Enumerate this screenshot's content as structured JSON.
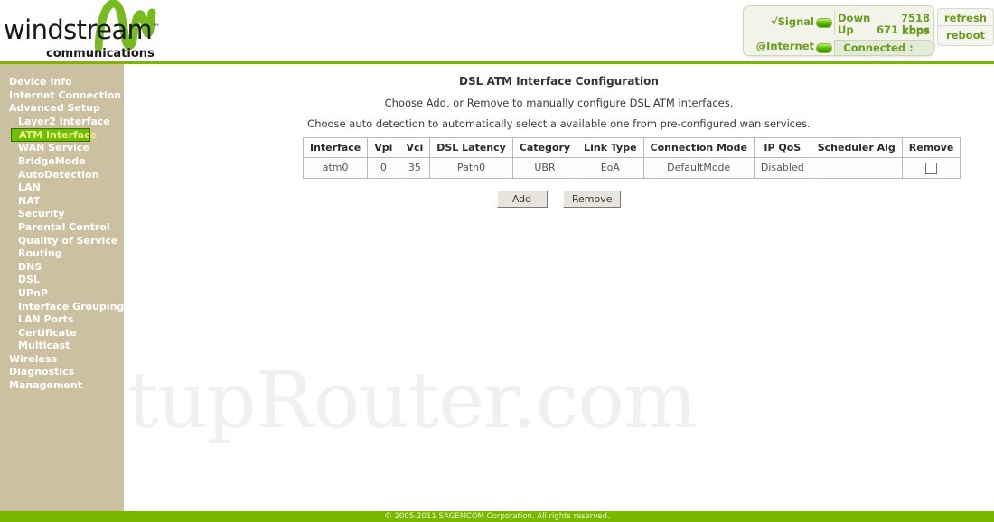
{
  "brand": {
    "name": "windstream",
    "trademark": "™",
    "tagline": "communications",
    "logo_icon": "windstream-wave-logo"
  },
  "status_panel": {
    "signal_label": "√Signal",
    "signal_led": "green-led",
    "internet_label": "@Internet",
    "internet_led": "green-led",
    "connection_status": "Connected :",
    "down_label": "Down",
    "down_value": "7518 kbps",
    "up_label": "Up",
    "up_value": "671 kbps",
    "refresh_label": "refresh",
    "reboot_label": "reboot",
    "accent_color": "#6a9c20"
  },
  "sidebar": {
    "background_color": "#cbc0a0",
    "active_color": "#6cc000",
    "items": [
      {
        "label": "Device Info",
        "level": 0,
        "active": false
      },
      {
        "label": "Internet Connection",
        "level": 0,
        "active": false
      },
      {
        "label": "Advanced Setup",
        "level": 0,
        "active": false
      },
      {
        "label": "Layer2 Interface",
        "level": 1,
        "active": false
      },
      {
        "label": "ATM Interface",
        "level": 1,
        "active": true
      },
      {
        "label": "WAN Service",
        "level": 1,
        "active": false
      },
      {
        "label": "BridgeMode",
        "level": 1,
        "active": false
      },
      {
        "label": "AutoDetection",
        "level": 1,
        "active": false
      },
      {
        "label": "LAN",
        "level": 1,
        "active": false
      },
      {
        "label": "NAT",
        "level": 1,
        "active": false
      },
      {
        "label": "Security",
        "level": 1,
        "active": false
      },
      {
        "label": "Parental Control",
        "level": 1,
        "active": false
      },
      {
        "label": "Quality of Service",
        "level": 1,
        "active": false
      },
      {
        "label": "Routing",
        "level": 1,
        "active": false
      },
      {
        "label": "DNS",
        "level": 1,
        "active": false
      },
      {
        "label": "DSL",
        "level": 1,
        "active": false
      },
      {
        "label": "UPnP",
        "level": 1,
        "active": false
      },
      {
        "label": "Interface Grouping",
        "level": 1,
        "active": false
      },
      {
        "label": "LAN Ports",
        "level": 1,
        "active": false
      },
      {
        "label": "Certificate",
        "level": 1,
        "active": false
      },
      {
        "label": "Multicast",
        "level": 1,
        "active": false
      },
      {
        "label": "Wireless",
        "level": 0,
        "active": false
      },
      {
        "label": "Diagnostics",
        "level": 0,
        "active": false
      },
      {
        "label": "Management",
        "level": 0,
        "active": false
      }
    ]
  },
  "main": {
    "title": "DSL ATM Interface Configuration",
    "description_line1": "Choose Add, or Remove to manually configure DSL ATM interfaces.",
    "description_line2": "Choose auto detection to automatically select a available one from pre-configured wan services.",
    "table": {
      "columns": [
        "Interface",
        "Vpi",
        "Vci",
        "DSL Latency",
        "Category",
        "Link Type",
        "Connection Mode",
        "IP QoS",
        "Scheduler Alg",
        "Remove"
      ],
      "rows": [
        {
          "interface": "atm0",
          "vpi": "0",
          "vci": "35",
          "dsl_latency": "Path0",
          "category": "UBR",
          "link_type": "EoA",
          "connection_mode": "DefaultMode",
          "ip_qos": "Disabled",
          "scheduler_alg": "",
          "remove_checked": false
        }
      ]
    },
    "buttons": {
      "add_label": "Add",
      "remove_label": "Remove"
    }
  },
  "watermark": {
    "text": "SetupRouter.com"
  },
  "footer": {
    "text": "© 2005-2011 SAGEMCOM Corporation. All rights reserved.",
    "background_color": "#7ab800"
  }
}
